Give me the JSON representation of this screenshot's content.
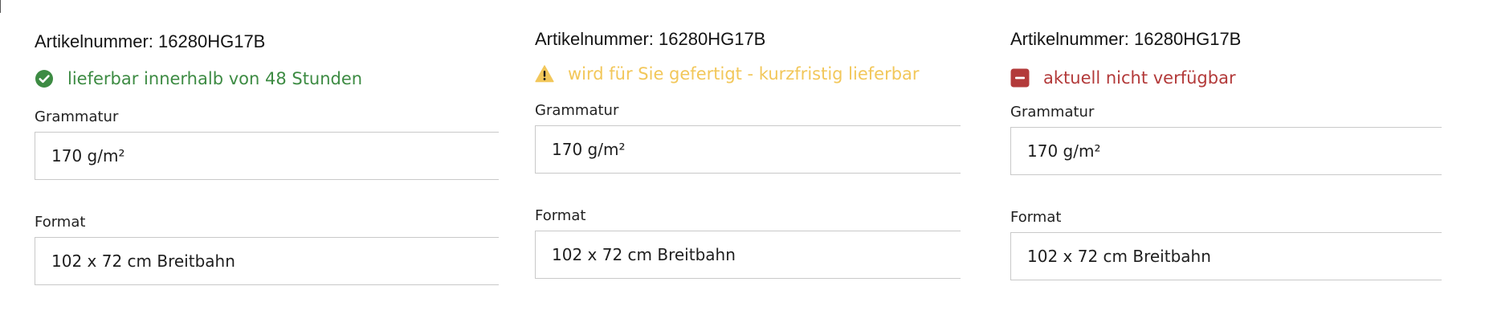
{
  "panels": [
    {
      "article": "Artikelnummer: 16280HG17B",
      "status": {
        "text": "lieferbar innerhalb von 48 Stunden",
        "icon": "check-circle-icon",
        "color": "#3d8b43"
      },
      "grammatur": {
        "label": "Grammatur",
        "value": "170 g/m²"
      },
      "format": {
        "label": "Format",
        "value": "102 x 72 cm Breitbahn"
      }
    },
    {
      "article": "Artikelnummer: 16280HG17B",
      "status": {
        "text": "wird für Sie gefertigt - kurzfristig lieferbar",
        "icon": "warning-triangle-icon",
        "color": "#f2c75a"
      },
      "grammatur": {
        "label": "Grammatur",
        "value": "170 g/m²"
      },
      "format": {
        "label": "Format",
        "value": "102 x 72 cm Breitbahn"
      }
    },
    {
      "article": "Artikelnummer: 16280HG17B",
      "status": {
        "text": "aktuell nicht verfügbar",
        "icon": "minus-square-icon",
        "color": "#b33a3a"
      },
      "grammatur": {
        "label": "Grammatur",
        "value": "170 g/m²"
      },
      "format": {
        "label": "Format",
        "value": "102 x 72 cm Breitbahn"
      }
    }
  ]
}
